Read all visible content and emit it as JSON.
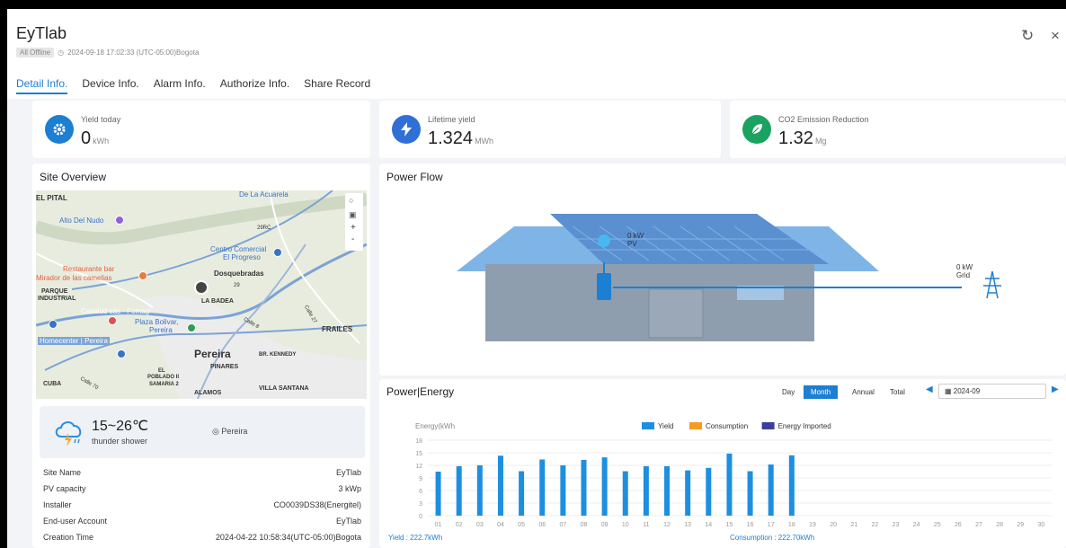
{
  "header": {
    "title": "EyTlab",
    "status_badge": "All Offline",
    "timestamp": "2024-09-18 17:02:33 (UTC-05:00)Bogota",
    "refresh_icon": "↻",
    "close_icon": "×"
  },
  "tabs": [
    {
      "label": "Detail Info.",
      "active": true
    },
    {
      "label": "Device Info."
    },
    {
      "label": "Alarm Info."
    },
    {
      "label": "Authorize Info."
    },
    {
      "label": "Share Record"
    }
  ],
  "stats": [
    {
      "label": "Yield today",
      "value": "0",
      "unit": "kWh",
      "icon": "gear-icon",
      "color": "#1d7fd1"
    },
    {
      "label": "Lifetime yield",
      "value": "1.324",
      "unit": "MWh",
      "icon": "bolt-icon",
      "color": "#2f6fd6"
    },
    {
      "label": "CO2 Emission Reduction",
      "value": "1.32",
      "unit": "Mg",
      "icon": "leaf-icon",
      "color": "#1aa260"
    }
  ],
  "site_overview": {
    "title": "Site Overview",
    "map_labels": [
      "EL PITAL",
      "De La Acuarela",
      "Alto Del Nudo",
      "29RC",
      "Centro Comercial",
      "El Progreso",
      "Restaurante bar",
      "Mirador de las camelias",
      "Dosquebradas",
      "29",
      "PARQUE",
      "INDUSTRIAL",
      "LA BADEA",
      "Casalud sas - Fomag",
      "Plaza Bolivar,",
      "Pereira",
      "Calle 8",
      "Calle 27",
      "FRAILES",
      "Homecenter | Pereira",
      "Pereira",
      "BR. KENNEDY",
      "PINARES",
      "EL",
      "POBLADO II",
      "CUBA",
      "Calle 70",
      "SAMARIA 2",
      "ALAMOS",
      "VILLA SANTANA"
    ],
    "weather": {
      "temp": "15~26℃",
      "desc": "thunder shower",
      "location": "Pereira"
    },
    "info": [
      {
        "label": "Site Name",
        "value": "EyTlab"
      },
      {
        "label": "PV capacity",
        "value": "3 kWp"
      },
      {
        "label": "Installer",
        "value": "CO0039DS38(Energitel)"
      },
      {
        "label": "End-user Account",
        "value": "EyTlab"
      },
      {
        "label": "Creation Time",
        "value": "2024-04-22 10:58:34(UTC-05:00)Bogota"
      }
    ]
  },
  "power_flow": {
    "title": "Power Flow",
    "pv_value": "0 kW",
    "pv_label": "PV",
    "grid_value": "0 kW",
    "grid_label": "Grid"
  },
  "power_energy": {
    "title": "Power|Energy",
    "ranges": [
      {
        "label": "Day"
      },
      {
        "label": "Month",
        "active": true
      },
      {
        "label": "Annual"
      },
      {
        "label": "Total"
      }
    ],
    "date": "2024-09",
    "yield_total": "Yield : 222.7kWh",
    "consumption_total": "Consumption : 222.70kWh"
  },
  "chart_data": {
    "type": "bar",
    "ylabel": "Energy(kWh",
    "ylim": [
      0,
      18
    ],
    "yticks": [
      0,
      3,
      6,
      9,
      12,
      15,
      18
    ],
    "categories": [
      "01",
      "02",
      "03",
      "04",
      "05",
      "06",
      "07",
      "08",
      "09",
      "10",
      "11",
      "12",
      "13",
      "14",
      "15",
      "16",
      "17",
      "18",
      "19",
      "20",
      "21",
      "22",
      "23",
      "24",
      "25",
      "26",
      "27",
      "28",
      "29",
      "30"
    ],
    "series": [
      {
        "name": "Yield",
        "color": "#1d8fe0",
        "values": [
          10.5,
          11.8,
          12.0,
          14.3,
          10.6,
          13.4,
          12.0,
          13.3,
          13.9,
          10.6,
          11.8,
          11.8,
          10.8,
          11.4,
          14.8,
          10.6,
          12.2,
          14.4,
          0,
          0,
          0,
          0,
          0,
          0,
          0,
          0,
          0,
          0,
          0,
          0
        ]
      },
      {
        "name": "Consumption",
        "color": "#f59a23",
        "values": []
      },
      {
        "name": "Energy Imported",
        "color": "#3a3f9e",
        "values": []
      }
    ],
    "legend": "top-center",
    "grid": true
  }
}
